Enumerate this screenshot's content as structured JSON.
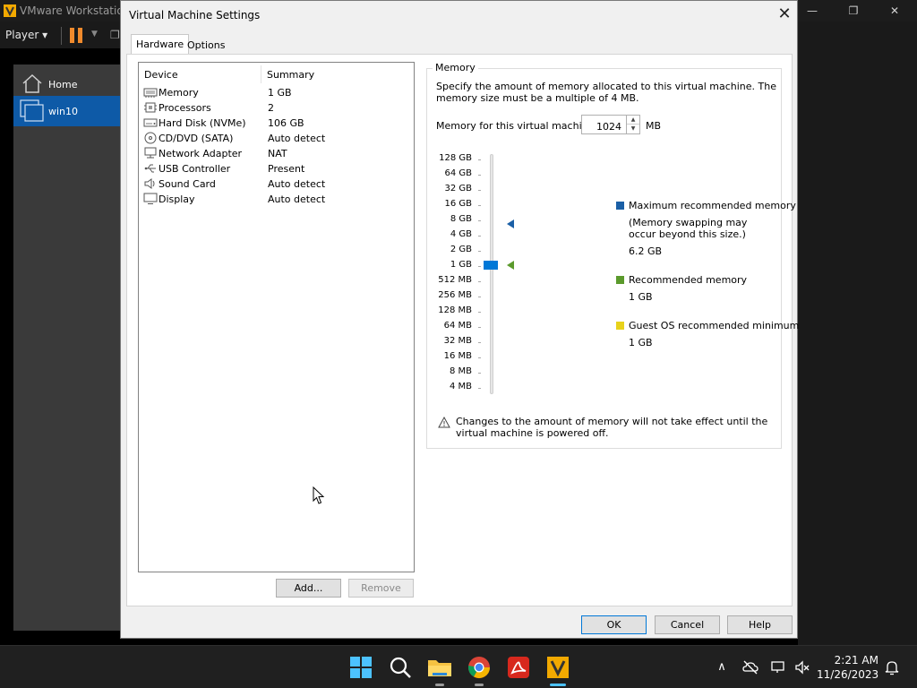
{
  "background_app": {
    "title": "VMware Workstation",
    "player_menu": "Player",
    "sidebar": {
      "home_label": "Home",
      "vm_label": "win10"
    }
  },
  "dialog": {
    "title": "Virtual Machine Settings",
    "tabs": [
      {
        "label": "Hardware",
        "active": true
      },
      {
        "label": "Options",
        "active": false
      }
    ],
    "device_list": {
      "headers": {
        "device": "Device",
        "summary": "Summary"
      },
      "rows": [
        {
          "name": "Memory",
          "summary": "1 GB",
          "icon": "memory-icon"
        },
        {
          "name": "Processors",
          "summary": "2",
          "icon": "processor-icon"
        },
        {
          "name": "Hard Disk (NVMe)",
          "summary": "106 GB",
          "icon": "hard-disk-icon"
        },
        {
          "name": "CD/DVD (SATA)",
          "summary": "Auto detect",
          "icon": "cd-dvd-icon"
        },
        {
          "name": "Network Adapter",
          "summary": "NAT",
          "icon": "network-adapter-icon"
        },
        {
          "name": "USB Controller",
          "summary": "Present",
          "icon": "usb-controller-icon"
        },
        {
          "name": "Sound Card",
          "summary": "Auto detect",
          "icon": "sound-card-icon"
        },
        {
          "name": "Display",
          "summary": "Auto detect",
          "icon": "display-icon"
        }
      ]
    },
    "add_button": "Add...",
    "remove_button": "Remove",
    "memory": {
      "group_title": "Memory",
      "description": "Specify the amount of memory allocated to this virtual machine. The memory size must be a multiple of 4 MB.",
      "field_label": "Memory for this virtual machine:",
      "value": "1024",
      "unit": "MB",
      "scale_labels": [
        "128 GB",
        "64 GB",
        "32 GB",
        "16 GB",
        "8 GB",
        "4 GB",
        "2 GB",
        "1 GB",
        "512 MB",
        "256 MB",
        "128 MB",
        "64 MB",
        "32 MB",
        "16 MB",
        "8 MB",
        "4 MB"
      ],
      "legend": {
        "max_title": "Maximum recommended memory",
        "max_note_1": "(Memory swapping may",
        "max_note_2": "occur beyond this size.)",
        "max_value": "6.2 GB",
        "rec_title": "Recommended memory",
        "rec_value": "1 GB",
        "guest_title": "Guest OS recommended minimum",
        "guest_value": "1 GB"
      },
      "colors": {
        "max": "#1a5fa6",
        "recommended": "#5b9a2c",
        "guest_min": "#e8d21a",
        "slider": "#0078d7"
      },
      "warning": "Changes to the amount of memory will not take effect until the virtual machine is powered off."
    },
    "buttons": {
      "ok": "OK",
      "cancel": "Cancel",
      "help": "Help"
    }
  },
  "taskbar": {
    "apps": [
      "start-icon",
      "search-icon",
      "file-explorer-icon",
      "chrome-icon",
      "acrobat-icon",
      "vmware-icon"
    ],
    "time": "2:21 AM",
    "date": "11/26/2023"
  }
}
